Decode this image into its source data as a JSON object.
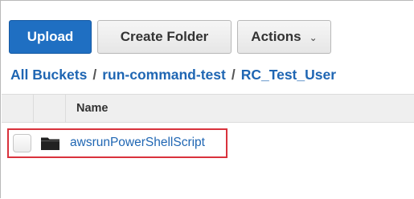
{
  "toolbar": {
    "upload_label": "Upload",
    "create_folder_label": "Create Folder",
    "actions_label": "Actions",
    "actions_caret": "⌄"
  },
  "breadcrumb": {
    "items": [
      "All Buckets",
      "run-command-test",
      "RC_Test_User"
    ],
    "separator": "/"
  },
  "table": {
    "columns": [
      "",
      "",
      "Name"
    ],
    "rows": [
      {
        "icon": "folder-icon",
        "name": "awsrunPowerShellScript",
        "selected": false,
        "highlighted": true
      }
    ]
  },
  "colors": {
    "primary": "#1f6fc2",
    "link": "#1f66b3",
    "highlight_border": "#d9323c"
  }
}
